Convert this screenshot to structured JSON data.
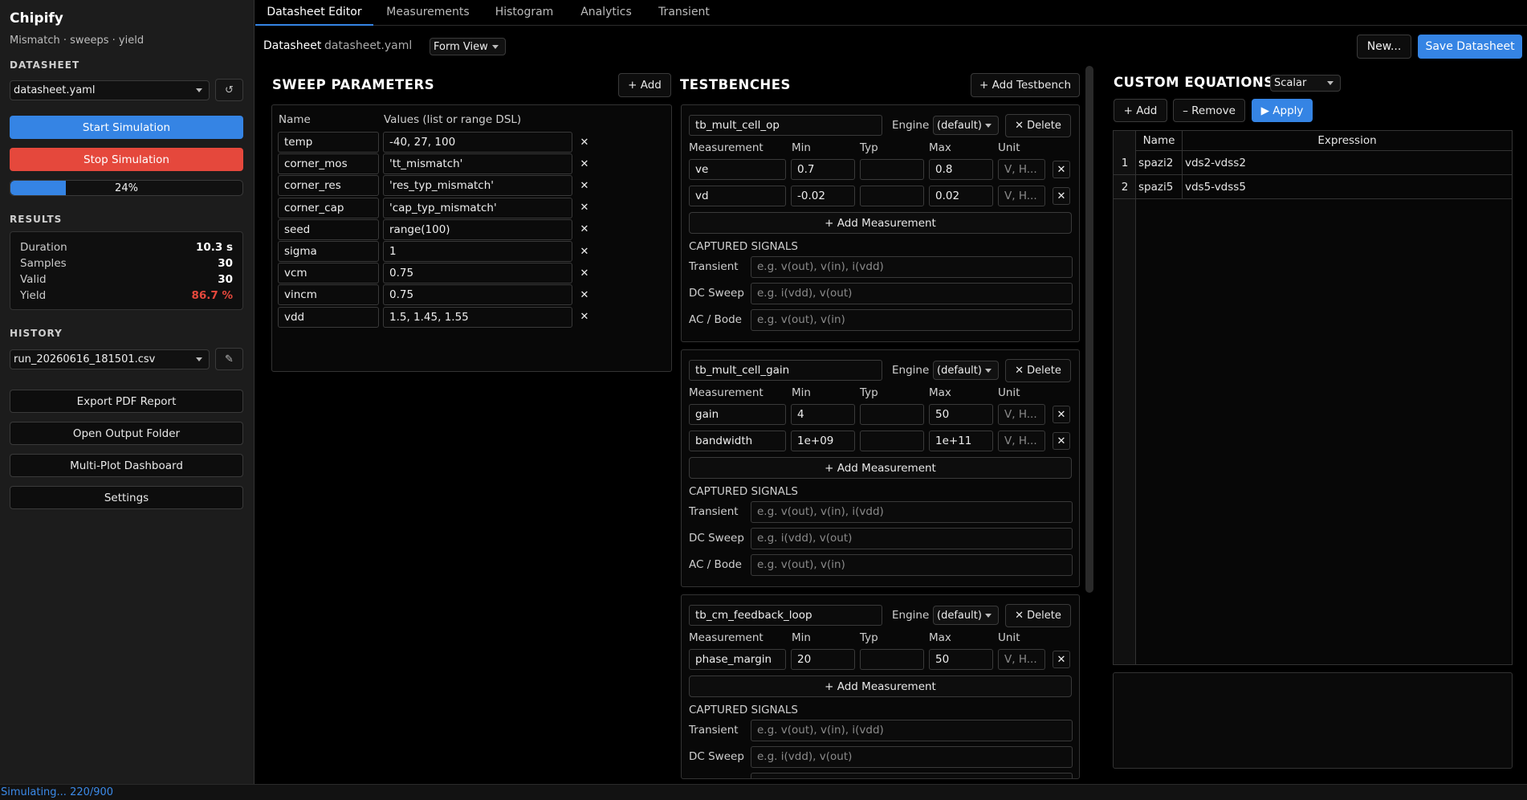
{
  "app": {
    "name": "Chipify",
    "tagline": "Mismatch · sweeps · yield"
  },
  "sidebar": {
    "datasheet_heading": "DATASHEET",
    "datasheet_select": "datasheet.yaml",
    "refresh_glyph": "↺",
    "start_label": "Start Simulation",
    "stop_label": "Stop Simulation",
    "progress_value": 24,
    "progress_label": "24%",
    "results_heading": "RESULTS",
    "results": [
      {
        "label": "Duration",
        "value": "10.3 s"
      },
      {
        "label": "Samples",
        "value": "30"
      },
      {
        "label": "Valid",
        "value": "30"
      },
      {
        "label": "Yield",
        "value": "86.7 %"
      }
    ],
    "history_heading": "HISTORY",
    "history_select": "run_20260616_181501.csv",
    "edit_glyph": "✎",
    "export_label": "Export PDF Report",
    "open_folder_label": "Open Output Folder",
    "dashboard_label": "Multi-Plot Dashboard",
    "settings_label": "Settings"
  },
  "tabs": [
    "Datasheet Editor",
    "Measurements",
    "Histogram",
    "Analytics",
    "Transient"
  ],
  "header": {
    "datasheet_label": "Datasheet",
    "datasheet_file": "datasheet.yaml",
    "view_select": "Form View",
    "new_label": "New...",
    "save_label": "Save Datasheet"
  },
  "sweep": {
    "title": "SWEEP PARAMETERS",
    "add_label": "+ Add",
    "col_name": "Name",
    "col_values": "Values  (list or range DSL)",
    "rows": [
      {
        "name": "temp",
        "values": "-40, 27, 100"
      },
      {
        "name": "corner_mos",
        "values": "'tt_mismatch'"
      },
      {
        "name": "corner_res",
        "values": "'res_typ_mismatch'"
      },
      {
        "name": "corner_cap",
        "values": "'cap_typ_mismatch'"
      },
      {
        "name": "seed",
        "values": "range(100)"
      },
      {
        "name": "sigma",
        "values": "1"
      },
      {
        "name": "vcm",
        "values": "0.75"
      },
      {
        "name": "vincm",
        "values": "0.75"
      },
      {
        "name": "vdd",
        "values": "1.5, 1.45, 1.55"
      }
    ]
  },
  "testbenches": {
    "title": "TESTBENCHES",
    "add_label": "+ Add Testbench",
    "engine_label": "Engine",
    "engine_value": "(default)",
    "delete_label": "✕ Delete",
    "col_measurement": "Measurement",
    "col_min": "Min",
    "col_typ": "Typ",
    "col_max": "Max",
    "col_unit": "Unit",
    "unit_placeholder": "V, H...",
    "add_measurement_label": "+ Add Measurement",
    "captured_heading": "CAPTURED SIGNALS",
    "signal_labels": [
      "Transient",
      "DC Sweep",
      "AC / Bode"
    ],
    "signal_placeholders": [
      "e.g.  v(out), v(in), i(vdd)",
      "e.g.  i(vdd), v(out)",
      "e.g.  v(out), v(in)"
    ],
    "items": [
      {
        "name": "tb_mult_cell_op",
        "measurements": [
          {
            "name": "ve",
            "min": "0.7",
            "typ": "",
            "max": "0.8"
          },
          {
            "name": "vd",
            "min": "-0.02",
            "typ": "",
            "max": "0.02"
          }
        ]
      },
      {
        "name": "tb_mult_cell_gain",
        "measurements": [
          {
            "name": "gain",
            "min": "4",
            "typ": "",
            "max": "50"
          },
          {
            "name": "bandwidth",
            "min": "1e+09",
            "typ": "",
            "max": "1e+11"
          }
        ]
      },
      {
        "name": "tb_cm_feedback_loop",
        "measurements": [
          {
            "name": "phase_margin",
            "min": "20",
            "typ": "",
            "max": "50"
          }
        ]
      }
    ]
  },
  "equations": {
    "title": "CUSTOM EQUATIONS",
    "mode_select": "Scalar",
    "add_label": "+ Add",
    "remove_label": "– Remove",
    "apply_label": "▶ Apply",
    "col_name": "Name",
    "col_expression": "Expression",
    "rows": [
      {
        "index": "1",
        "name": "spazi2",
        "expression": "vds2-vdss2"
      },
      {
        "index": "2",
        "name": "spazi5",
        "expression": "vds5-vdss5"
      }
    ]
  },
  "status_text": "Simulating... 220/900",
  "colors": {
    "accent": "#3584e4",
    "danger": "#e5483c",
    "background": "#000000",
    "sidebar": "#1c1c1c"
  }
}
